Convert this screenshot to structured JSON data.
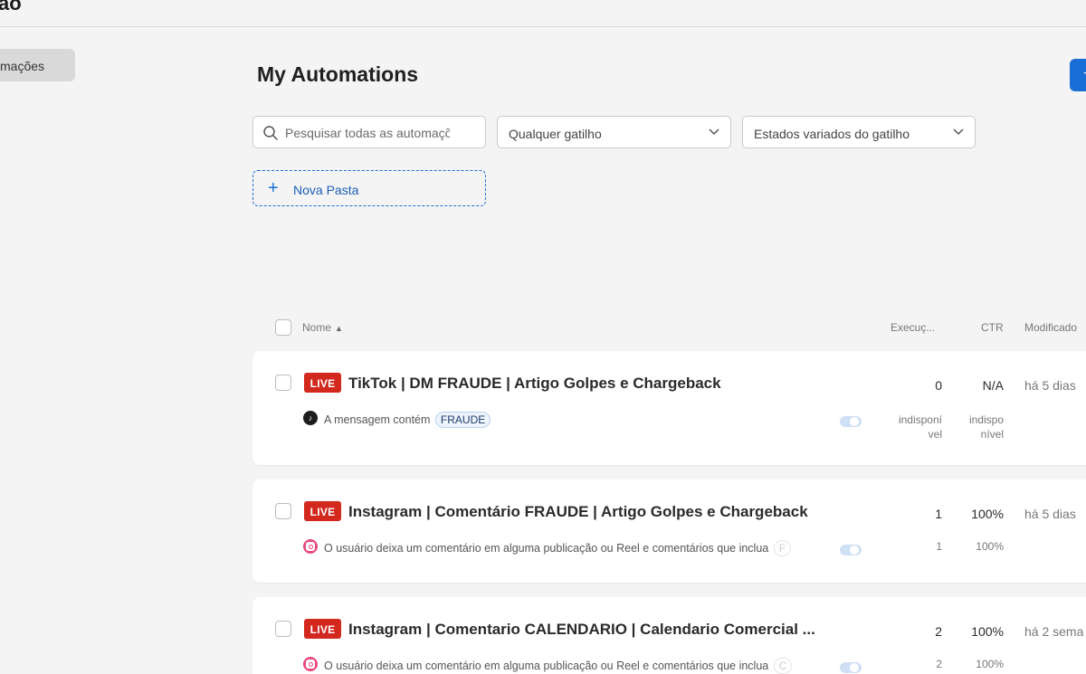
{
  "topbar": {
    "title": "ão"
  },
  "sidebar": {
    "active_item": "mações"
  },
  "page": {
    "title": "My Automations",
    "create_button": "+"
  },
  "filters": {
    "search_placeholder": "Pesquisar todas as automações",
    "trigger_select": "Qualquer gatilho",
    "state_select": "Estados variados do gatilho"
  },
  "new_folder": {
    "label": "Nova Pasta"
  },
  "table": {
    "headers": {
      "name": "Nome",
      "executions": "Execuç...",
      "ctr": "CTR",
      "modified": "Modificado"
    },
    "rows": [
      {
        "status": "LIVE",
        "title": "TikTok | DM FRAUDE | Artigo Golpes e Chargeback",
        "trigger_platform": "tiktok-icon",
        "trigger_text": "A mensagem contém",
        "keyword": "FRAUDE",
        "executions": "0",
        "executions_sub": "indisponí\nvel",
        "ctr": "N/A",
        "ctr_sub": "indispo\nnível",
        "modified": "há 5 dias"
      },
      {
        "status": "LIVE",
        "title": "Instagram | Comentário FRAUDE | Artigo Golpes e Chargeback",
        "trigger_platform": "instagram-icon",
        "trigger_text": "O usuário deixa um comentário em alguma publicação ou Reel e comentários que inclua",
        "keyword": "F",
        "executions": "1",
        "executions_sub": "1",
        "ctr": "100%",
        "ctr_sub": "100%",
        "modified": "há 5 dias"
      },
      {
        "status": "LIVE",
        "title": "Instagram | Comentario CALENDARIO | Calendario Comercial ...",
        "trigger_platform": "instagram-icon",
        "trigger_text": "O usuário deixa um comentário em alguma publicação ou Reel e comentários que inclua",
        "keyword": "C",
        "executions": "2",
        "executions_sub": "2",
        "ctr": "100%",
        "ctr_sub": "100%",
        "modified": "há 2 sema"
      }
    ]
  }
}
